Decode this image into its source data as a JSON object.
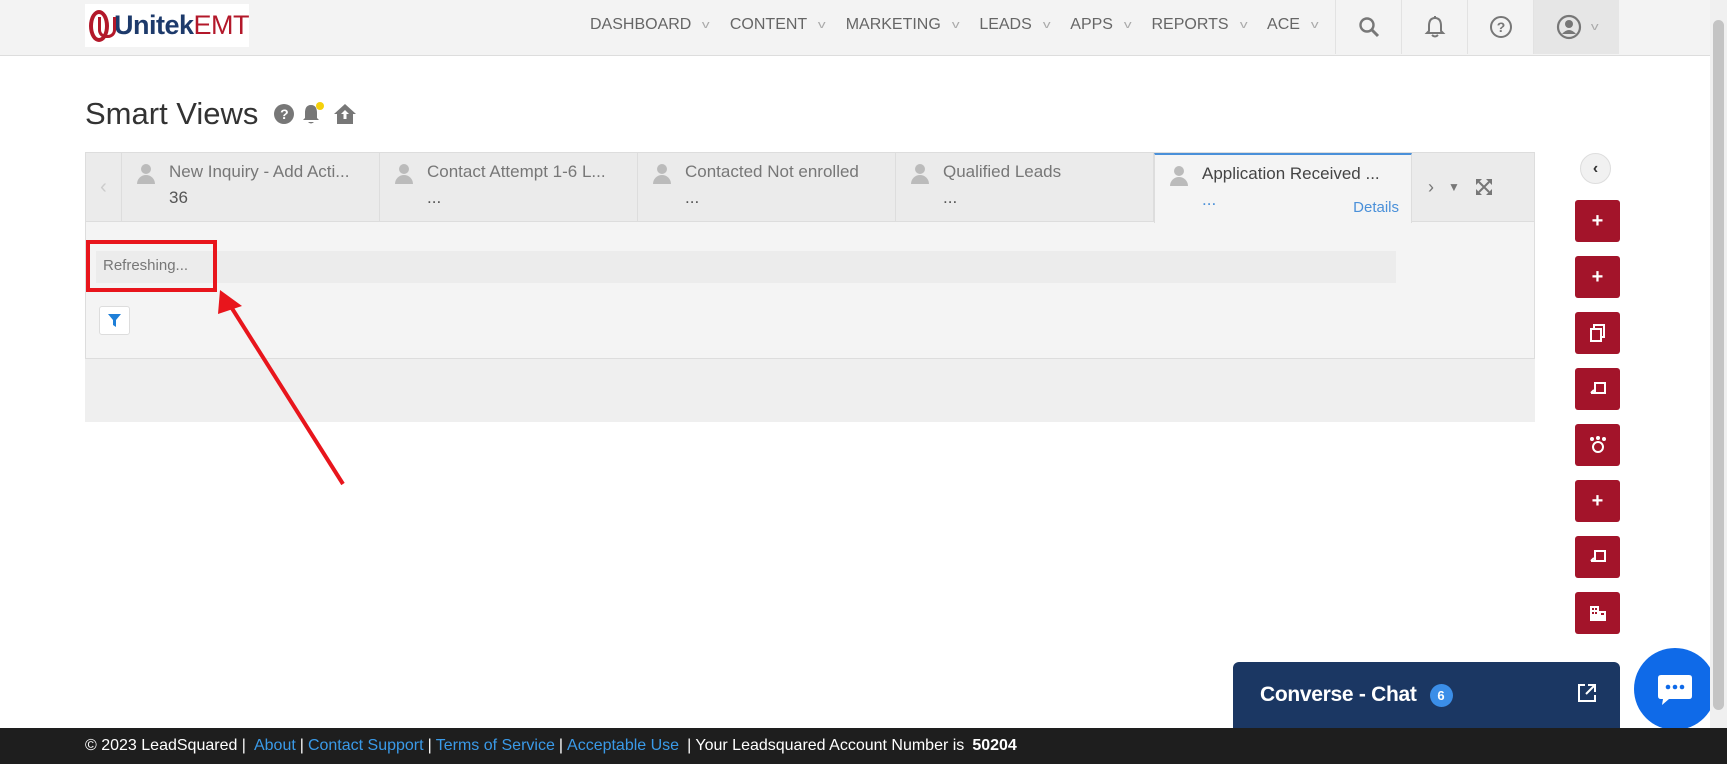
{
  "header": {
    "logo_brand": "Unitek",
    "logo_suffix": "EMT",
    "nav": [
      {
        "label": "DASHBOARD"
      },
      {
        "label": "CONTENT"
      },
      {
        "label": "MARKETING"
      },
      {
        "label": "LEADS"
      },
      {
        "label": "APPS"
      },
      {
        "label": "REPORTS"
      },
      {
        "label": "ACE"
      }
    ],
    "icons": [
      "search-icon",
      "bell-icon",
      "help-icon",
      "profile-icon"
    ]
  },
  "page": {
    "title": "Smart Views"
  },
  "tabs": [
    {
      "name": "New Inquiry - Add Acti...",
      "count": "36"
    },
    {
      "name": "Contact Attempt 1-6 L...",
      "count": "..."
    },
    {
      "name": "Contacted Not enrolled",
      "count": "..."
    },
    {
      "name": "Qualified Leads",
      "count": "..."
    },
    {
      "name": "Application Received ...",
      "count": "...",
      "details": "Details"
    }
  ],
  "status": {
    "refreshing": "Refreshing..."
  },
  "chat": {
    "title": "Converse - Chat",
    "badge": "6"
  },
  "footer": {
    "copyright": "© 2023 LeadSquared |",
    "about": "About",
    "contact_support": "Contact Support",
    "terms": "Terms of Service",
    "acceptable_use": "Acceptable Use",
    "account_prefix": "| Your Leadsquared Account Number is",
    "account_number": "50204"
  },
  "colors": {
    "accent": "#a3142a",
    "link": "#4a90d9",
    "chat": "#1b3763",
    "highlight": "#e8151c"
  }
}
